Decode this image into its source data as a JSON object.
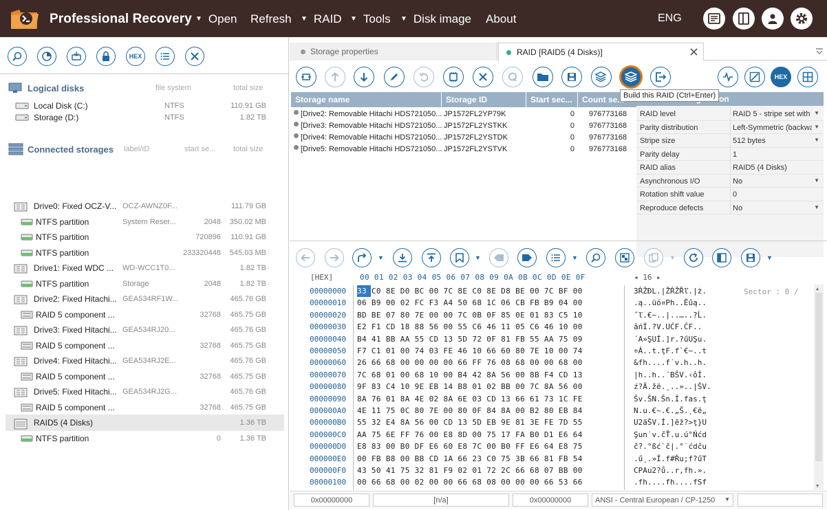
{
  "app": {
    "title": "Professional Recovery"
  },
  "menu": [
    {
      "label": "Open",
      "dropdown": true
    },
    {
      "label": "Refresh",
      "dropdown": false
    },
    {
      "label": "RAID",
      "dropdown": true
    },
    {
      "label": "Tools",
      "dropdown": true
    },
    {
      "label": "Disk image",
      "dropdown": false
    },
    {
      "label": "About",
      "dropdown": false
    }
  ],
  "lang": "ENG",
  "left": {
    "logical": {
      "title": "Logical disks",
      "col_fs": "file system",
      "col_size": "total size",
      "items": [
        {
          "name": "Local Disk (C:)",
          "fs": "NTFS",
          "size": "110.91 GB"
        },
        {
          "name": "Storage (D:)",
          "fs": "NTFS",
          "size": "1.82 TB"
        }
      ]
    },
    "storages": {
      "title": "Connected storages",
      "col_label": "label/ID",
      "col_start": "start se...",
      "col_size": "total size",
      "items": [
        {
          "name": "Drive0: Fixed OCZ-V...",
          "label": "OCZ-AWNZ0F...",
          "start": "",
          "size": "111.79 GB",
          "level": 0,
          "kind": "drive"
        },
        {
          "name": "NTFS partition",
          "label": "System Reser...",
          "start": "2048",
          "size": "350.02 MB",
          "level": 1,
          "kind": "part"
        },
        {
          "name": "NTFS partition",
          "label": "",
          "start": "720896",
          "size": "110.91 GB",
          "level": 1,
          "kind": "part"
        },
        {
          "name": "NTFS partition",
          "label": "",
          "start": "233320448",
          "size": "545.03 MB",
          "level": 1,
          "kind": "part"
        },
        {
          "name": "Drive1: Fixed WDC ...",
          "label": "WD-WCC1T0...",
          "start": "",
          "size": "1.82 TB",
          "level": 0,
          "kind": "drive"
        },
        {
          "name": "NTFS partition",
          "label": "Storage",
          "start": "2048",
          "size": "1.82 TB",
          "level": 1,
          "kind": "part"
        },
        {
          "name": "Drive2: Fixed Hitachi...",
          "label": "GEA534RF1W...",
          "start": "",
          "size": "465.76 GB",
          "level": 0,
          "kind": "drive"
        },
        {
          "name": "RAID 5 component ...",
          "label": "",
          "start": "32768",
          "size": "465.75 GB",
          "level": 1,
          "kind": "raidcomp"
        },
        {
          "name": "Drive3: Fixed Hitachi...",
          "label": "GEA534RJ20...",
          "start": "",
          "size": "465.76 GB",
          "level": 0,
          "kind": "drive"
        },
        {
          "name": "RAID 5 component ...",
          "label": "",
          "start": "32768",
          "size": "465.75 GB",
          "level": 1,
          "kind": "raidcomp"
        },
        {
          "name": "Drive4: Fixed Hitachi...",
          "label": "GEA534RJ2E...",
          "start": "",
          "size": "465.76 GB",
          "level": 0,
          "kind": "drive"
        },
        {
          "name": "RAID 5 component ...",
          "label": "",
          "start": "32768",
          "size": "465.75 GB",
          "level": 1,
          "kind": "raidcomp"
        },
        {
          "name": "Drive5: Fixed Hitachi...",
          "label": "GEA534RJ2G...",
          "start": "",
          "size": "465.76 GB",
          "level": 0,
          "kind": "drive"
        },
        {
          "name": "RAID 5 component ...",
          "label": "",
          "start": "32768",
          "size": "465.75 GB",
          "level": 1,
          "kind": "raidcomp"
        },
        {
          "name": "RAID5 (4 Disks)",
          "label": "",
          "start": "",
          "size": "1.36 TB",
          "level": 0,
          "kind": "raid",
          "selected": true
        },
        {
          "name": "NTFS partition",
          "label": "",
          "start": "0",
          "size": "1.36 TB",
          "level": 1,
          "kind": "part"
        }
      ]
    }
  },
  "tabs": [
    {
      "label": "Storage properties",
      "dot_color": "#999999",
      "active": false
    },
    {
      "label": "RAID [RAID5 (4 Disks)]",
      "dot_color": "#2fb08a",
      "active": true
    }
  ],
  "tooltip": "Build this RAID (Ctrl+Enter)",
  "storage_table": {
    "headers": [
      "Storage name",
      "Storage ID",
      "Start sec...",
      "Count se..."
    ],
    "rows": [
      [
        "[Drive2: Removable Hitachi HDS721050...",
        "JP1572FL2YP79K",
        "0",
        "976773168"
      ],
      [
        "[Drive3: Removable Hitachi HDS721050...",
        "JP1572FL2YSTKK",
        "0",
        "976773168"
      ],
      [
        "[Drive4: Removable Hitachi HDS721050...",
        "JP1572FL2YSTDK",
        "0",
        "976773168"
      ],
      [
        "[Drive5: Removable Hitachi HDS721050...",
        "JP1572FL2YSTVK",
        "0",
        "976773168"
      ]
    ]
  },
  "raid_config": {
    "title": "configuration",
    "rows": [
      {
        "key": "RAID level",
        "value": "RAID 5 - stripe set with",
        "dropdown": true
      },
      {
        "key": "Parity distribution",
        "value": "Left-Symmetric (backwa",
        "dropdown": true
      },
      {
        "key": "Stripe size",
        "value": "512 bytes",
        "dropdown": true
      },
      {
        "key": "Parity delay",
        "value": "1",
        "dropdown": false
      },
      {
        "key": "RAID alias",
        "value": "RAID5 (4 Disks)",
        "dropdown": false
      },
      {
        "key": "Asynchronous I/O",
        "value": "No",
        "dropdown": true
      },
      {
        "key": "Rotation shift value",
        "value": "0",
        "dropdown": false
      },
      {
        "key": "Reproduce defects",
        "value": "No",
        "dropdown": true
      }
    ]
  },
  "hex": {
    "header_label": "[HEX]",
    "columns": "00 01 02 03 04 05 06 07 08 09 0A 0B 0C 0D 0E 0F",
    "width_label": "16",
    "sector_text": "Sector : 0 /",
    "offsets": [
      "00000000",
      "00000010",
      "00000020",
      "00000030",
      "00000040",
      "00000050",
      "00000060",
      "00000070",
      "00000080",
      "00000090",
      "000000A0",
      "000000B0",
      "000000C0",
      "000000D0",
      "000000E0",
      "000000F0",
      "00000100"
    ],
    "bytes": [
      "33 C0 8E D0 BC 00 7C 8E C0 8E D8 BE 00 7C BF 00",
      "06 B9 00 02 FC F3 A4 50 68 1C 06 CB FB B9 04 00",
      "BD BE 07 80 7E 00 00 7C 0B 0F 85 0E 01 83 C5 10",
      "E2 F1 CD 18 88 56 00 55 C6 46 11 05 C6 46 10 00",
      "B4 41 BB AA 55 CD 13 5D 72 0F 81 FB 55 AA 75 09",
      "F7 C1 01 00 74 03 FE 46 10 66 60 80 7E 10 00 74",
      "26 66 68 00 00 00 00 66 FF 76 08 68 00 00 68 00",
      "7C 68 01 00 68 10 00 B4 42 8A 56 00 8B F4 CD 13",
      "9F 83 C4 10 9E EB 14 B8 01 02 BB 00 7C 8A 56 00",
      "8A 76 01 8A 4E 02 8A 6E 03 CD 13 66 61 73 1C FE",
      "4E 11 75 0C 80 7E 00 80 0F 84 8A 00 B2 80 EB 84",
      "55 32 E4 8A 56 00 CD 13 5D EB 9E 81 3E FE 7D 55",
      "AA 75 6E FF 76 00 E8 8D 00 75 17 FA B0 D1 E6 64",
      "E8 83 00 B0 DF E6 60 E8 7C 00 B0 FF E6 64 E8 75",
      "00 FB B8 00 BB CD 1A 66 23 C0 75 3B 66 81 FB 54",
      "43 50 41 75 32 81 F9 02 01 72 2C 66 68 07 BB 00",
      "00 66 68 00 02 00 00 66 68 08 00 00 00 66 53 66"
    ],
    "text": [
      "3ŔŽĐL.|ŽŔŽŘľ.|ż.",
      ".ą..üó¤Ph..Ëűą..",
      "˝ľ.€~..|..…..?Ĺ.",
      "âńÍ.?V.UĆF.ĆF..",
      "´A»ŞUÍ.]r.?űUŞu.",
      "÷Á..t.ţF.f`€~..t",
      "&fh....f˙v.h..h.",
      "|h..h..´BŠV.‹ôÍ.",
      "ź?Ä.žë.¸..»..|ŠV.",
      "Šv.ŠN.Šn.Í.fas.ţ",
      "N.u.€~.€.„Š.˛€ë„",
      "U2äŠV.Í.]ëž?>ţ}U",
      "Şun˙v.čŤ.u.ú°Ńćd",
      "č?.°ßć`č|.°˙ćdču",
      ".ű¸.»Í.f#Ŕu;f?űT",
      "CPAu2?ů..r,fh.».",
      ".fh....fh....fSf"
    ]
  },
  "status": {
    "offset": "0x00000000",
    "value": "[n/a]",
    "offset2": "0x00000000",
    "encoding": "ANSI - Central European / CP-1250"
  }
}
